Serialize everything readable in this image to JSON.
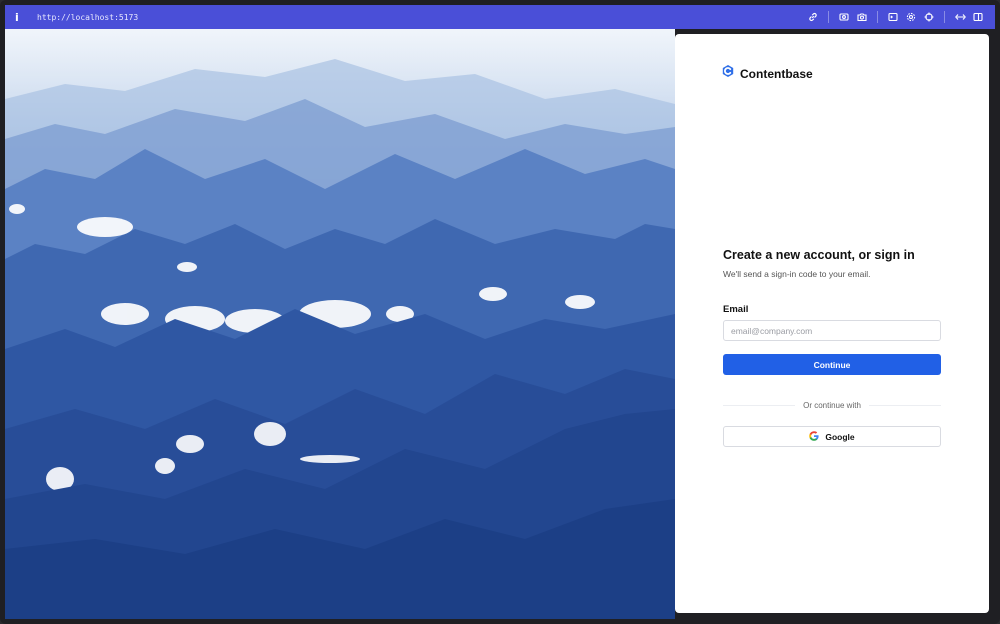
{
  "browser": {
    "url": "http://localhost:5173",
    "info_glyph": "i",
    "toolbar_icons": [
      "link-icon",
      "screenshot-icon",
      "camera-icon",
      "terminal-icon",
      "settings-icon",
      "crosshair-icon",
      "resize-icon",
      "sidebar-icon"
    ]
  },
  "hero": {
    "image_description_icon": "mountain-landscape-image",
    "colors": {
      "sky": "#dfe9f5",
      "mid": "#4d7fc4",
      "deep": "#1d438c"
    }
  },
  "brand": {
    "name": "Contentbase",
    "logo_color": "#2f6fe8"
  },
  "auth": {
    "heading": "Create a new account, or sign in",
    "subheading": "We'll send a sign-in code to your email.",
    "email_label": "Email",
    "email_placeholder": "email@company.com",
    "email_value": "",
    "continue_label": "Continue",
    "divider_text": "Or continue with",
    "google_label": "Google"
  },
  "colors": {
    "accent": "#2160e6",
    "toolbar": "#4a4fd8"
  }
}
